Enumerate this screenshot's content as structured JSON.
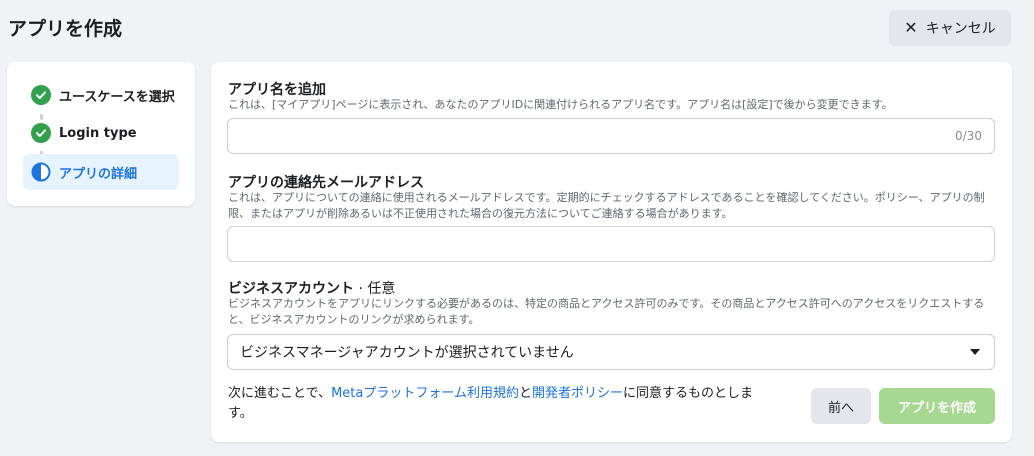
{
  "header": {
    "title": "アプリを作成",
    "cancel_label": "キャンセル"
  },
  "steps": [
    {
      "label": "ユースケースを選択",
      "status": "complete"
    },
    {
      "label": "Login type",
      "status": "complete"
    },
    {
      "label": "アプリの詳細",
      "status": "current"
    }
  ],
  "form": {
    "app_name": {
      "label": "アプリ名を追加",
      "description": "これは、[マイアプリ]ページに表示され、あなたのアプリIDに関連付けられるアプリ名です。アプリ名は[設定]で後から変更できます。",
      "value": "",
      "counter": "0/30"
    },
    "contact_email": {
      "label": "アプリの連絡先メールアドレス",
      "description": "これは、アプリについての連絡に使用されるメールアドレスです。定期的にチェックするアドレスであることを確認してください。ポリシー、アプリの制限、またはアプリが削除あるいは不正使用された場合の復元方法についてご連絡する場合があります。",
      "value": ""
    },
    "business_account": {
      "label": "ビジネスアカウント",
      "optional": " · 任意",
      "description": "ビジネスアカウントをアプリにリンクする必要があるのは、特定の商品とアクセス許可のみです。その商品とアクセス許可へのアクセスをリクエストすると、ビジネスアカウントのリンクが求められます。",
      "selected": "ビジネスマネージャアカウントが選択されていません"
    }
  },
  "footer": {
    "terms_prefix": "次に進むことで、",
    "terms_link1": "Metaプラットフォーム利用規約",
    "terms_mid": "と",
    "terms_link2": "開発者ポリシー",
    "terms_suffix": "に同意するものとします。",
    "back_label": "前へ",
    "create_label": "アプリを作成"
  },
  "colors": {
    "complete": "#31a24c",
    "accent": "#1b74e4",
    "create_disabled": "#a7d891"
  }
}
